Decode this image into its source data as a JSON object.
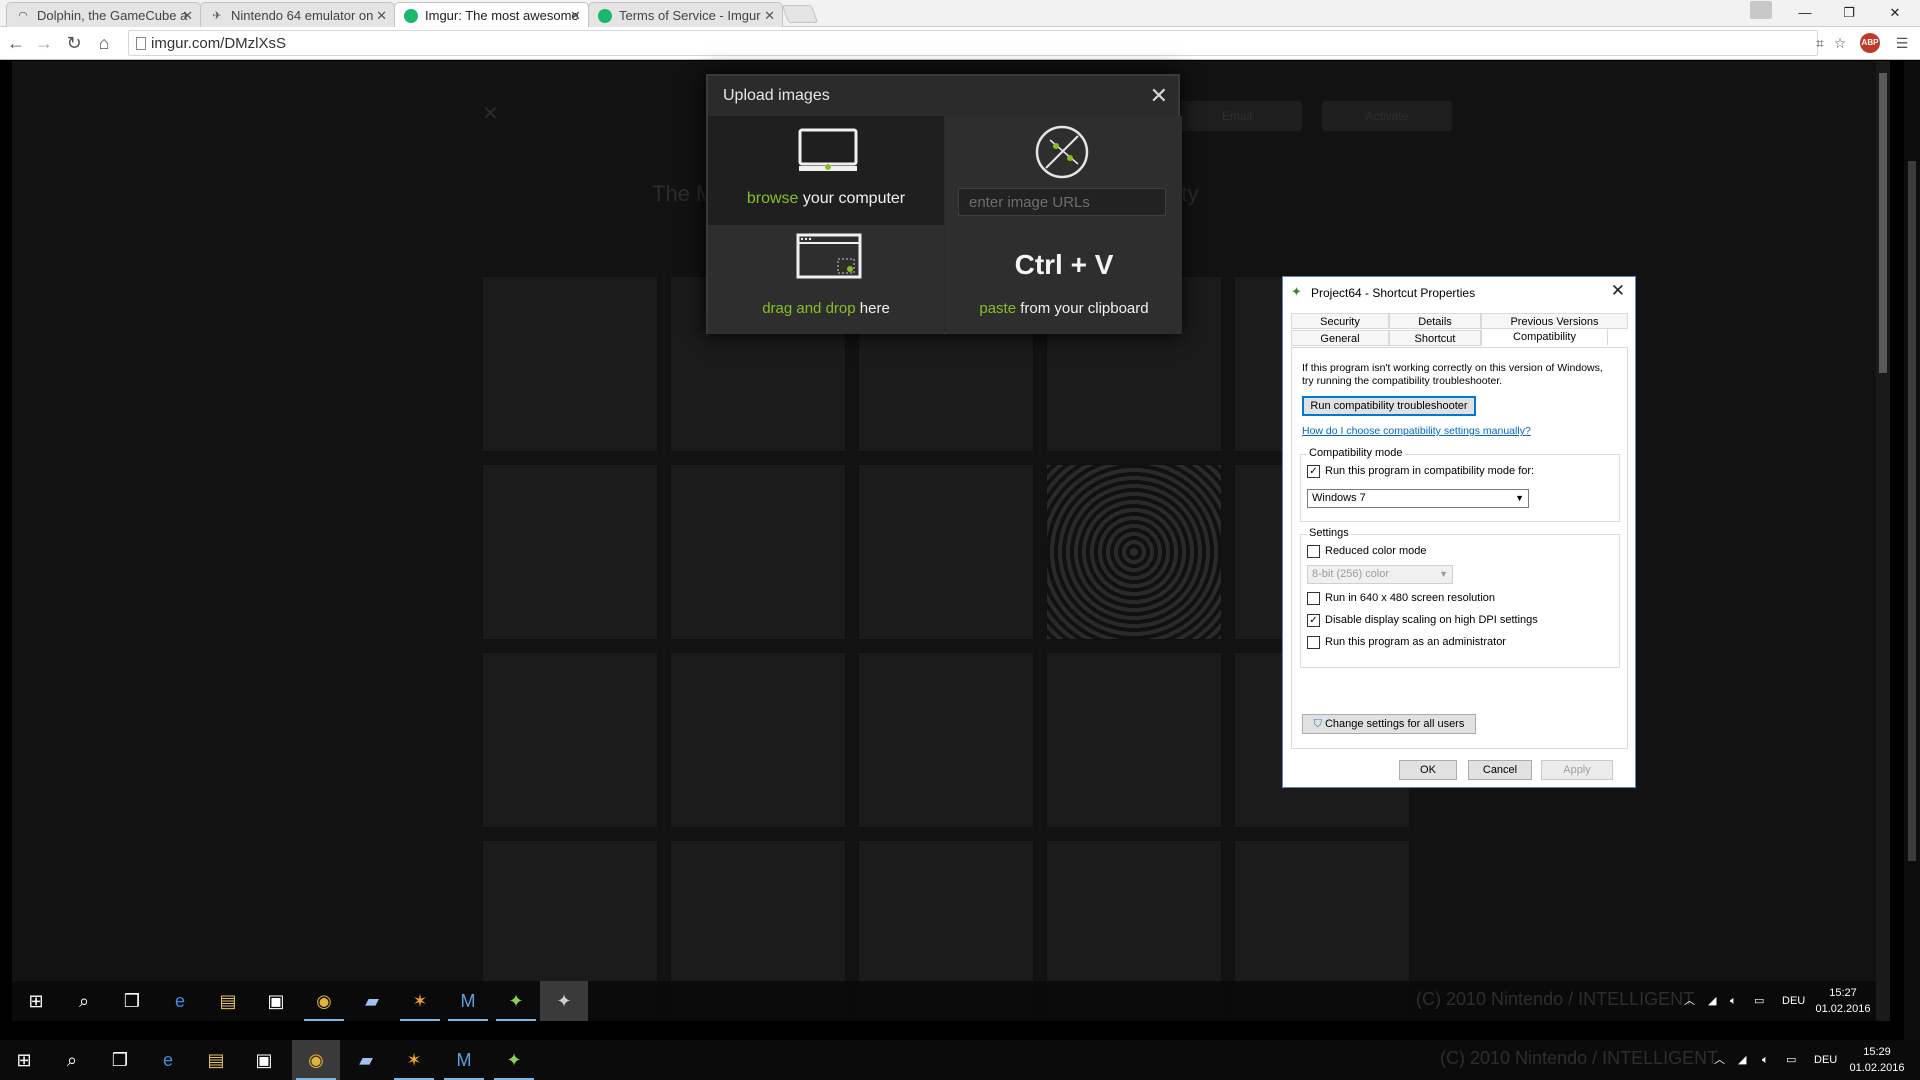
{
  "browser": {
    "tabs": [
      {
        "title": "Dolphin, the GameCube a",
        "active": false
      },
      {
        "title": "Nintendo 64 emulator on",
        "active": false
      },
      {
        "title": "Imgur: The most awesome",
        "active": true
      },
      {
        "title": "Terms of Service - Imgur",
        "active": false
      }
    ],
    "url": "imgur.com/DMzlXsS"
  },
  "background_page": {
    "title_left": "The M",
    "title_right": "larity",
    "btn_left": "Email",
    "btn_right": "Activate"
  },
  "upload_modal": {
    "title": "Upload images",
    "browse_accent": "browse",
    "browse_rest": " your computer",
    "url_placeholder": "enter image URLs",
    "drag_accent": "drag and drop",
    "drag_rest": " here",
    "shortcut": "Ctrl + V",
    "paste_accent": "paste",
    "paste_rest": " from your clipboard",
    "accent_color": "#85bf25"
  },
  "dialog": {
    "title": "Project64 - Shortcut Properties",
    "tabs_top": [
      "Security",
      "Details",
      "Previous Versions"
    ],
    "tabs_bottom": [
      "General",
      "Shortcut",
      "Compatibility"
    ],
    "active_tab": "Compatibility",
    "intro_line1": "If this program isn't working correctly on this version of Windows,",
    "intro_line2": "try running the compatibility troubleshooter.",
    "troubleshooter_button": "Run compatibility troubleshooter",
    "manual_link": "How do I choose compatibility settings manually?",
    "compat_group": "Compatibility mode",
    "compat_checkbox": "Run this program in compatibility mode for:",
    "compat_checked": true,
    "compat_os": "Windows 7",
    "settings_group": "Settings",
    "reduced_color": "Reduced color mode",
    "color_depth": "8-bit (256) color",
    "res_640": "Run in 640 x 480 screen resolution",
    "dpi_scaling": "Disable display scaling on high DPI settings",
    "run_admin": "Run this program as an administrator",
    "change_all_button": "Change settings for all users",
    "ok": "OK",
    "cancel": "Cancel",
    "apply": "Apply"
  },
  "inner_taskbar": {
    "lang": "DEU",
    "time": "15:27",
    "date": "01.02.2016",
    "watermark": "(C) 2010 Nintendo / INTELLIGENT"
  },
  "outer_taskbar": {
    "lang": "DEU",
    "time": "15:29",
    "date": "01.02.2016",
    "watermark": "(C) 2010 Nintendo / INTELLIGENT"
  }
}
